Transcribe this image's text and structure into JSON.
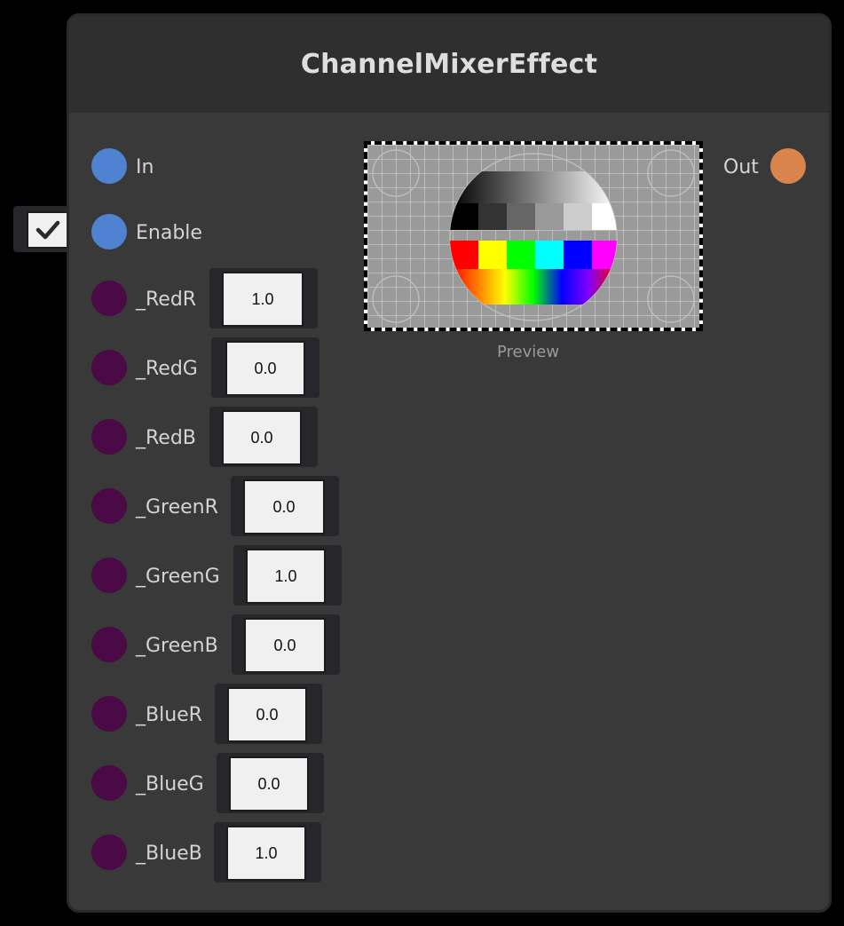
{
  "node": {
    "title": "ChannelMixerEffect"
  },
  "ports": {
    "in_label": "In",
    "enable_label": "Enable",
    "out_label": "Out",
    "enable_checked": true,
    "colors": {
      "flow": "#4f82d0",
      "param": "#4a0a45",
      "out": "#d8844c"
    }
  },
  "params": [
    {
      "label": "_RedR",
      "value": "1.0"
    },
    {
      "label": "_RedG",
      "value": "0.0"
    },
    {
      "label": "_RedB",
      "value": "0.0"
    },
    {
      "label": "_GreenR",
      "value": "0.0"
    },
    {
      "label": "_GreenG",
      "value": "1.0"
    },
    {
      "label": "_GreenB",
      "value": "0.0"
    },
    {
      "label": "_BlueR",
      "value": "0.0"
    },
    {
      "label": "_BlueG",
      "value": "0.0"
    },
    {
      "label": "_BlueB",
      "value": "1.0"
    }
  ],
  "preview": {
    "label": "Preview",
    "image": "test-pattern"
  }
}
